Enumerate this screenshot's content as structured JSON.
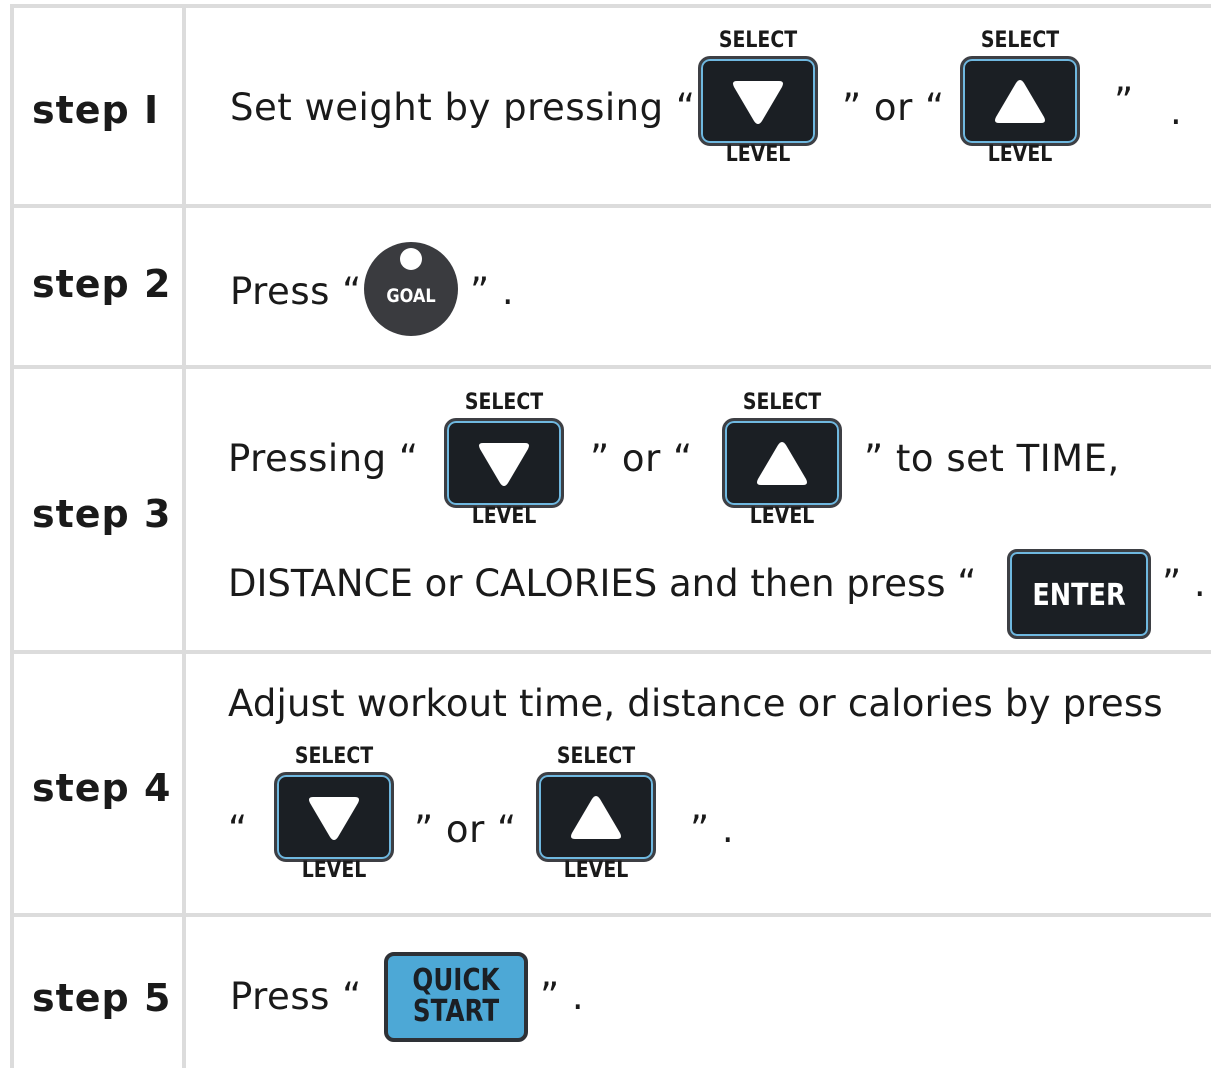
{
  "key_labels": {
    "top": "SELECT",
    "bottom": "LEVEL"
  },
  "quote_open": "“",
  "quote_close": "”",
  "step1": {
    "label": "step I",
    "text": "Set weight by pressing “",
    "or": "” or “",
    "end": "”",
    "period": "."
  },
  "step2": {
    "label": "step 2",
    "text": "Press “",
    "goal_label": "GOAL",
    "end": "” ."
  },
  "step3": {
    "label": "step 3",
    "text": "Pressing  “",
    "or": "” or “",
    "to_set": "”  to set TIME,",
    "line2": "DISTANCE or CALORIES and then press “",
    "enter_label": "ENTER",
    "end": "” ."
  },
  "step4": {
    "label": "step 4",
    "line1": "Adjust workout time, distance or calories by press",
    "open": "“",
    "or": "” or “",
    "end": "” ."
  },
  "step5": {
    "label": "step 5",
    "text": "Press  “",
    "quick_label_1": "QUICK",
    "quick_label_2": "START",
    "end": "” ."
  },
  "colors": {
    "key_bg": "#1b1f24",
    "key_accent": "#6fb8e0",
    "quick_start": "#4da8d6",
    "goal_bg": "#3a3b3f",
    "grid": "#dcdcdc"
  },
  "icons": {
    "down": "triangle-down-icon",
    "up": "triangle-up-icon"
  }
}
